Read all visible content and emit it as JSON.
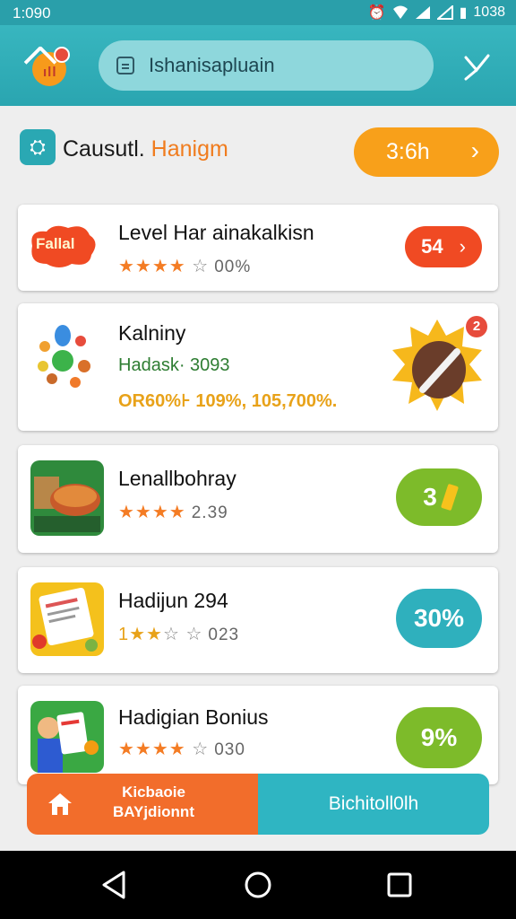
{
  "status_bar": {
    "time": "1:090",
    "battery": "1038"
  },
  "app_bar": {
    "search_text": "Ishanisapluain"
  },
  "section": {
    "title_part1": "Causutl.",
    "title_part2": "Hanigm",
    "button_label": "3:6h"
  },
  "cards": [
    {
      "logo_text": "Fallal",
      "title": "Level Har ainakalkisn",
      "stars_filled": 4,
      "stars_total": 5,
      "rating_text": "00%",
      "badge": "54"
    },
    {
      "title": "Kalniny",
      "subtitle": "Hadask·  3093",
      "stats": "OR60%⊦ 109%, 105,700%.",
      "badge_dot": "2"
    },
    {
      "title": "Lenallbohray",
      "stars_filled": 4,
      "stars_total": 4,
      "rating_text": "2.39",
      "badge": "3"
    },
    {
      "title": "Hadijun 294",
      "stars_filled": 2,
      "stars_total": 4,
      "stars_prefix": "1",
      "rating_text": "023",
      "badge": "30%"
    },
    {
      "title": "Hadigian Bonius",
      "stars_filled": 4,
      "stars_total": 5,
      "rating_text": "030",
      "badge": "9%"
    }
  ],
  "action_bar": {
    "left_line1": "Kicbaoie",
    "left_line2": "BAYjdionnt",
    "right_label": "Bichitoll0lh"
  },
  "colors": {
    "teal": "#2aa5b0",
    "orange": "#f8a01a",
    "red_orange": "#f26d2b",
    "green": "#7dbb2a"
  }
}
